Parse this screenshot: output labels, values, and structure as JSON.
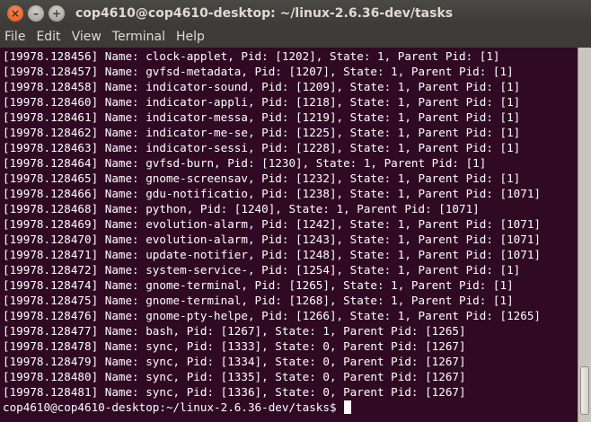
{
  "window": {
    "title": "cop4610@cop4610-desktop: ~/linux-2.6.36-dev/tasks",
    "controls": {
      "close": "×",
      "minimize": "–",
      "maximize": "+"
    }
  },
  "menu": [
    "File",
    "Edit",
    "View",
    "Terminal",
    "Help"
  ],
  "terminal": {
    "lines": [
      "[19978.128456] Name: clock-applet, Pid: [1202], State: 1, Parent Pid: [1]",
      "[19978.128457] Name: gvfsd-metadata, Pid: [1207], State: 1, Parent Pid: [1]",
      "[19978.128458] Name: indicator-sound, Pid: [1209], State: 1, Parent Pid: [1]",
      "[19978.128460] Name: indicator-appli, Pid: [1218], State: 1, Parent Pid: [1]",
      "[19978.128461] Name: indicator-messa, Pid: [1219], State: 1, Parent Pid: [1]",
      "[19978.128462] Name: indicator-me-se, Pid: [1225], State: 1, Parent Pid: [1]",
      "[19978.128463] Name: indicator-sessi, Pid: [1228], State: 1, Parent Pid: [1]",
      "[19978.128464] Name: gvfsd-burn, Pid: [1230], State: 1, Parent Pid: [1]",
      "[19978.128465] Name: gnome-screensav, Pid: [1232], State: 1, Parent Pid: [1]",
      "[19978.128466] Name: gdu-notificatio, Pid: [1238], State: 1, Parent Pid: [1071]",
      "[19978.128468] Name: python, Pid: [1240], State: 1, Parent Pid: [1071]",
      "[19978.128469] Name: evolution-alarm, Pid: [1242], State: 1, Parent Pid: [1071]",
      "[19978.128470] Name: evolution-alarm, Pid: [1243], State: 1, Parent Pid: [1071]",
      "[19978.128471] Name: update-notifier, Pid: [1248], State: 1, Parent Pid: [1071]",
      "[19978.128472] Name: system-service-, Pid: [1254], State: 1, Parent Pid: [1]",
      "[19978.128474] Name: gnome-terminal, Pid: [1265], State: 1, Parent Pid: [1]",
      "[19978.128475] Name: gnome-terminal, Pid: [1268], State: 1, Parent Pid: [1]",
      "[19978.128476] Name: gnome-pty-helpe, Pid: [1266], State: 1, Parent Pid: [1265]",
      "[19978.128477] Name: bash, Pid: [1267], State: 1, Parent Pid: [1265]",
      "[19978.128478] Name: sync, Pid: [1333], State: 0, Parent Pid: [1267]",
      "[19978.128479] Name: sync, Pid: [1334], State: 0, Parent Pid: [1267]",
      "[19978.128480] Name: sync, Pid: [1335], State: 0, Parent Pid: [1267]",
      "[19978.128481] Name: sync, Pid: [1336], State: 0, Parent Pid: [1267]"
    ],
    "prompt": "cop4610@cop4610-desktop:~/linux-2.6.36-dev/tasks$ "
  },
  "colors": {
    "terminal_bg": "#300a24",
    "terminal_fg": "#ffffff",
    "titlebar_bg": "#3c3b37",
    "close_button": "#e0551c"
  }
}
